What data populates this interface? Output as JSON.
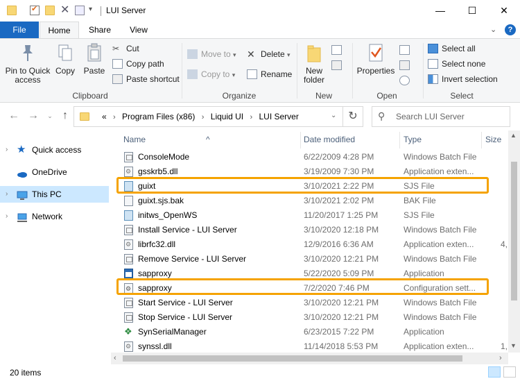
{
  "window": {
    "title": "LUI Server",
    "minimize": "—",
    "maximize": "☐",
    "close": "✕"
  },
  "tabs": [
    {
      "label": "File"
    },
    {
      "label": "Home"
    },
    {
      "label": "Share"
    },
    {
      "label": "View"
    }
  ],
  "ribbon": {
    "clipboard": {
      "label": "Clipboard",
      "pin": "Pin to Quick access",
      "copy": "Copy",
      "paste": "Paste",
      "cut": "Cut",
      "copy_path": "Copy path",
      "paste_shortcut": "Paste shortcut"
    },
    "organize": {
      "label": "Organize",
      "move_to": "Move to",
      "copy_to": "Copy to",
      "delete": "Delete",
      "rename": "Rename"
    },
    "new": {
      "label": "New",
      "new_folder": "New folder"
    },
    "open": {
      "label": "Open",
      "properties": "Properties"
    },
    "select": {
      "label": "Select",
      "select_all": "Select all",
      "select_none": "Select none",
      "invert": "Invert selection"
    }
  },
  "address": {
    "overflow": "«",
    "crumbs": [
      "Program Files (x86)",
      "Liquid UI",
      "LUI Server"
    ],
    "search_placeholder": "Search LUI Server"
  },
  "nav": [
    {
      "label": "Quick access"
    },
    {
      "label": "OneDrive"
    },
    {
      "label": "This PC"
    },
    {
      "label": "Network"
    }
  ],
  "columns": {
    "name": "Name",
    "date": "Date modified",
    "type": "Type",
    "size": "Size"
  },
  "files": [
    {
      "name": "ConsoleMode",
      "date": "6/22/2009 4:28 PM",
      "type": "Windows Batch File",
      "size": "",
      "icon": "bat"
    },
    {
      "name": "gsskrb5.dll",
      "date": "3/19/2009 7:30 PM",
      "type": "Application exten...",
      "size": "",
      "icon": "dll"
    },
    {
      "name": "guixt",
      "date": "3/10/2021 2:22 PM",
      "type": "SJS File",
      "size": "",
      "icon": "sjs"
    },
    {
      "name": "guixt.sjs.bak",
      "date": "3/10/2021 2:02 PM",
      "type": "BAK File",
      "size": "",
      "icon": "bak"
    },
    {
      "name": "initws_OpenWS",
      "date": "11/20/2017 1:25 PM",
      "type": "SJS File",
      "size": "",
      "icon": "sjs"
    },
    {
      "name": "Install Service - LUI Server",
      "date": "3/10/2020 12:18 PM",
      "type": "Windows Batch File",
      "size": "",
      "icon": "bat"
    },
    {
      "name": "librfc32.dll",
      "date": "12/9/2016 6:36 AM",
      "type": "Application exten...",
      "size": "4,",
      "icon": "dll"
    },
    {
      "name": "Remove Service - LUI Server",
      "date": "3/10/2020 12:21 PM",
      "type": "Windows Batch File",
      "size": "",
      "icon": "bat"
    },
    {
      "name": "sapproxy",
      "date": "5/22/2020 5:09 PM",
      "type": "Application",
      "size": "",
      "icon": "app"
    },
    {
      "name": "sapproxy",
      "date": "7/2/2020 7:46 PM",
      "type": "Configuration sett...",
      "size": "",
      "icon": "cfg"
    },
    {
      "name": "Start Service - LUI Server",
      "date": "3/10/2020 12:21 PM",
      "type": "Windows Batch File",
      "size": "",
      "icon": "bat"
    },
    {
      "name": "Stop Service - LUI Server",
      "date": "3/10/2020 12:21 PM",
      "type": "Windows Batch File",
      "size": "",
      "icon": "bat"
    },
    {
      "name": "SynSerialManager",
      "date": "6/23/2015 7:22 PM",
      "type": "Application",
      "size": "",
      "icon": "syn"
    },
    {
      "name": "synssl.dll",
      "date": "11/14/2018 5:53 PM",
      "type": "Application exten...",
      "size": "1,",
      "icon": "dll"
    }
  ],
  "status": {
    "count": "20 items"
  },
  "colors": {
    "accent": "#1a69c2",
    "highlight": "#f5a300",
    "selection": "#cce8ff"
  }
}
